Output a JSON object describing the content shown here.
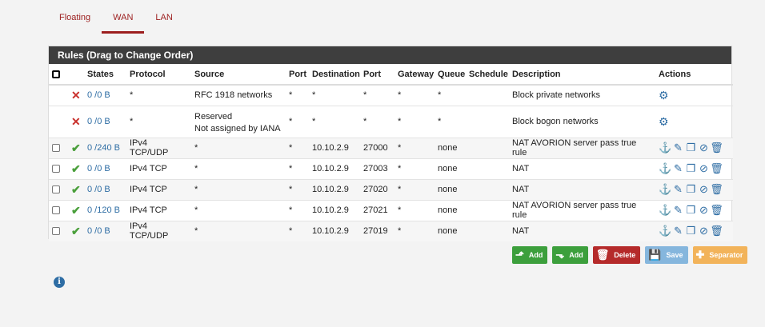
{
  "tabs": [
    "Floating",
    "WAN",
    "LAN"
  ],
  "panel_title": "Rules (Drag to Change Order)",
  "columns": [
    "States",
    "Protocol",
    "Source",
    "Port",
    "Destination",
    "Port",
    "Gateway",
    "Queue",
    "Schedule",
    "Description",
    "Actions"
  ],
  "rules": [
    {
      "states": "0 /0 B",
      "protocol": "*",
      "source": "RFC 1918 networks",
      "source2": "",
      "sport": "*",
      "dest": "*",
      "dport": "*",
      "gateway": "*",
      "queue": "*",
      "schedule": "",
      "desc": "Block private networks"
    },
    {
      "states": "0 /0 B",
      "protocol": "*",
      "source": "Reserved",
      "source2": "Not assigned by IANA",
      "sport": "*",
      "dest": "*",
      "dport": "*",
      "gateway": "*",
      "queue": "*",
      "schedule": "",
      "desc": "Block bogon networks"
    },
    {
      "states": "0 /240 B",
      "protocol": "IPv4 TCP/UDP",
      "source": "*",
      "source2": "",
      "sport": "*",
      "dest": "10.10.2.9",
      "dport": "27000",
      "gateway": "*",
      "queue": "none",
      "schedule": "",
      "desc": "NAT AVORION server pass true rule"
    },
    {
      "states": "0 /0 B",
      "protocol": "IPv4 TCP",
      "source": "*",
      "source2": "",
      "sport": "*",
      "dest": "10.10.2.9",
      "dport": "27003",
      "gateway": "*",
      "queue": "none",
      "schedule": "",
      "desc": "NAT"
    },
    {
      "states": "0 /0 B",
      "protocol": "IPv4 TCP",
      "source": "*",
      "source2": "",
      "sport": "*",
      "dest": "10.10.2.9",
      "dport": "27020",
      "gateway": "*",
      "queue": "none",
      "schedule": "",
      "desc": "NAT"
    },
    {
      "states": "0 /120 B",
      "protocol": "IPv4 TCP",
      "source": "*",
      "source2": "",
      "sport": "*",
      "dest": "10.10.2.9",
      "dport": "27021",
      "gateway": "*",
      "queue": "none",
      "schedule": "",
      "desc": "NAT AVORION server pass true rule"
    },
    {
      "states": "0 /0 B",
      "protocol": "IPv4 TCP/UDP",
      "source": "*",
      "source2": "",
      "sport": "*",
      "dest": "10.10.2.9",
      "dport": "27019",
      "gateway": "*",
      "queue": "none",
      "schedule": "",
      "desc": "NAT"
    }
  ],
  "buttons": {
    "add_top": "Add",
    "add_bottom": "Add",
    "delete": "Delete",
    "save": "Save",
    "separator": "Separator"
  },
  "colors": {
    "brand": "#9c1e1e",
    "header": "#3e3e3e",
    "link": "#2e6da4",
    "pass": "#4a9f3b",
    "block": "#c9302c"
  }
}
